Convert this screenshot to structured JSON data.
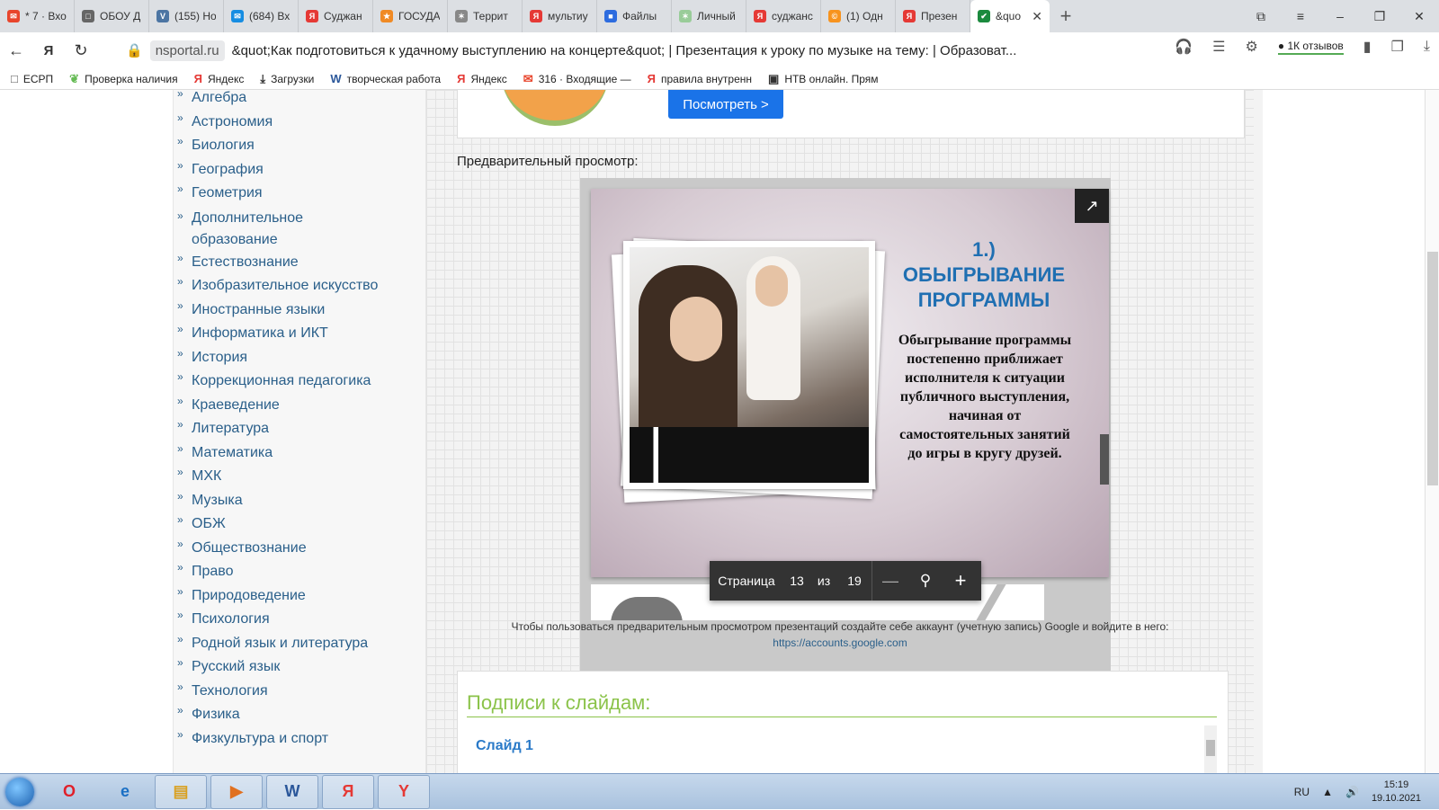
{
  "tabs": [
    {
      "label": "* 7 · Вхо",
      "fav_color": "#e8452c",
      "fav": "✉"
    },
    {
      "label": "ОБОУ Д",
      "fav_color": "#666",
      "fav": "□"
    },
    {
      "label": "(155) Но",
      "fav_color": "#4c75a3",
      "fav": "V"
    },
    {
      "label": "(684) Вх",
      "fav_color": "#168de2",
      "fav": "✉"
    },
    {
      "label": "Суджан",
      "fav_color": "#e53935",
      "fav": "Я"
    },
    {
      "label": "ГОСУДА",
      "fav_color": "#f08a24",
      "fav": "★"
    },
    {
      "label": "Террит",
      "fav_color": "#888",
      "fav": "✶"
    },
    {
      "label": "мультиу",
      "fav_color": "#e53935",
      "fav": "Я"
    },
    {
      "label": "Файлы",
      "fav_color": "#2d6cdf",
      "fav": "■"
    },
    {
      "label": "Личный",
      "fav_color": "#9c9",
      "fav": "✶"
    },
    {
      "label": "суджанс",
      "fav_color": "#e53935",
      "fav": "Я"
    },
    {
      "label": "(1) Одн",
      "fav_color": "#f7931e",
      "fav": "©"
    },
    {
      "label": "Презен",
      "fav_color": "#e53935",
      "fav": "Я"
    }
  ],
  "active_tab": {
    "label": "&quo",
    "fav_color": "#1b8a3e",
    "fav": "✔"
  },
  "address": {
    "domain": "nsportal.ru",
    "title": "&quot;Как подготовиться к удачному выступлению на концерте&quot; | Презентация к уроку по музыке на тему: | Образоват...",
    "reviews": "1К отзывов"
  },
  "bookmarks": [
    {
      "label": "ЕСРП",
      "icon": "□",
      "color": "#555"
    },
    {
      "label": "Проверка наличия",
      "icon": "❦",
      "color": "#6b5"
    },
    {
      "label": "Яндекс",
      "icon": "Я",
      "color": "#e53935"
    },
    {
      "label": "Загрузки",
      "icon": "⤓",
      "color": "#333"
    },
    {
      "label": "творческая работа",
      "icon": "W",
      "color": "#2b579a"
    },
    {
      "label": "Яндекс",
      "icon": "Я",
      "color": "#e53935"
    },
    {
      "label": "316 · Входящие —",
      "icon": "✉",
      "color": "#e8452c"
    },
    {
      "label": "правила внутренн",
      "icon": "Я",
      "color": "#e53935"
    },
    {
      "label": "НТВ онлайн. Прям",
      "icon": "▣",
      "color": "#333"
    }
  ],
  "subjects": [
    "Алгебра",
    "Астрономия",
    "Биология",
    "География",
    "Геометрия",
    "Дополнительное образование",
    "Естествознание",
    "Изобразительное искусство",
    "Иностранные языки",
    "Информатика и ИКТ",
    "История",
    "Коррекционная педагогика",
    "Краеведение",
    "Литература",
    "Математика",
    "МХК",
    "Музыка",
    "ОБЖ",
    "Обществознание",
    "Право",
    "Природоведение",
    "Психология",
    "Родной язык и литература",
    "Русский язык",
    "Технология",
    "Физика",
    "Физкультура и спорт"
  ],
  "promo": {
    "button": "Посмотреть >"
  },
  "preview_label": "Предварительный просмотр:",
  "slide": {
    "title": "1.) ОБЫГРЫВАНИЕ ПРОГРАММЫ",
    "body": "Обыгрывание программы постепенно приближает исполнителя к ситуации публичного выступления, начиная от самостоятельных занятий до игры в кругу друзей."
  },
  "viewer_toolbar": {
    "page_label": "Страница",
    "current": "13",
    "of_label": "из",
    "total": "19"
  },
  "notice": {
    "text": "Чтобы пользоваться предварительным просмотром презентаций создайте себе аккаунт (учетную запись) Google и войдите в него:",
    "link": "https://accounts.google.com"
  },
  "captions": {
    "title": "Подписи к слайдам:",
    "first": "Слайд 1"
  },
  "taskbar": {
    "apps": [
      {
        "icon": "O",
        "color": "#e0202a"
      },
      {
        "icon": "e",
        "color": "#1a6fc4"
      },
      {
        "icon": "▤",
        "color": "#d9a020"
      },
      {
        "icon": "▶",
        "color": "#e07020"
      },
      {
        "icon": "W",
        "color": "#2b579a"
      },
      {
        "icon": "Я",
        "color": "#e53935"
      },
      {
        "icon": "Y",
        "color": "#e53935"
      }
    ],
    "lang": "RU",
    "time": "15:19",
    "date": "19.10.2021"
  }
}
